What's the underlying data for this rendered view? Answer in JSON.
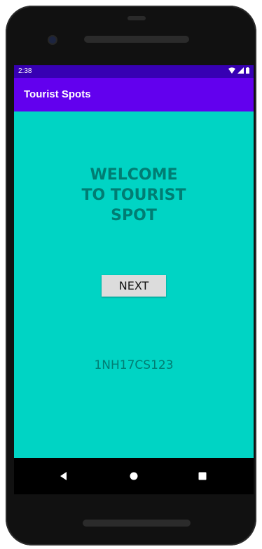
{
  "status_bar": {
    "time": "2:38",
    "icons": [
      "wifi-icon",
      "signal-icon",
      "battery-icon"
    ]
  },
  "app_bar": {
    "title": "Tourist Spots"
  },
  "main": {
    "welcome_text": "WELCOME\nTO TOURIST\nSPOT",
    "next_button_label": "NEXT",
    "roll_number": "1NH17CS123"
  },
  "nav_bar": {
    "icons": [
      "back-icon",
      "home-icon",
      "recents-icon"
    ]
  },
  "colors": {
    "status_bar": "#3700b3",
    "app_bar": "#6200ee",
    "background": "#00d4c4",
    "text_accent": "#007d73",
    "button": "#dcdcdc"
  }
}
